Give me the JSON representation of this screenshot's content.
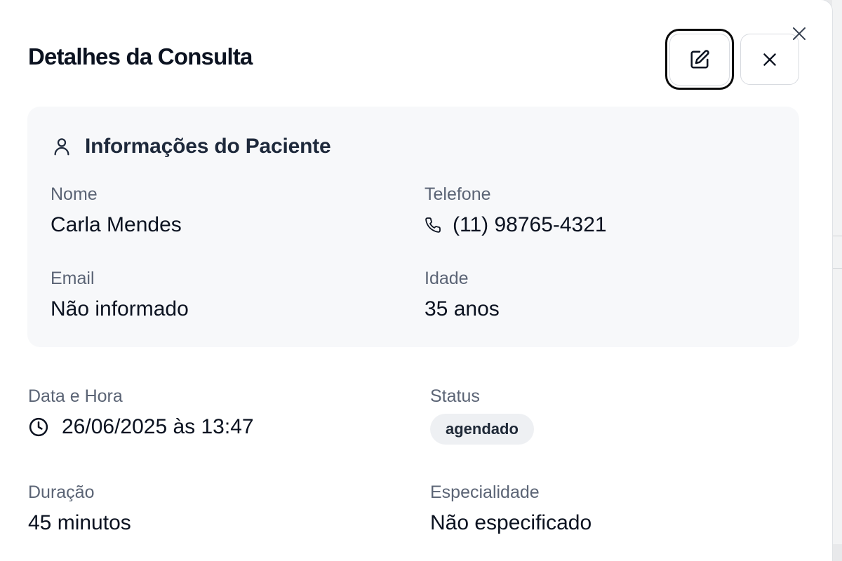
{
  "modal": {
    "title": "Detalhes da Consulta"
  },
  "patient": {
    "section_title": "Informações do Paciente",
    "name_label": "Nome",
    "name_value": "Carla Mendes",
    "phone_label": "Telefone",
    "phone_value": "(11) 98765-4321",
    "email_label": "Email",
    "email_value": "Não informado",
    "age_label": "Idade",
    "age_value": "35 anos"
  },
  "appointment": {
    "datetime_label": "Data e Hora",
    "datetime_value": "26/06/2025 às 13:47",
    "status_label": "Status",
    "status_value": "agendado",
    "duration_label": "Duração",
    "duration_value": "45 minutos",
    "specialty_label": "Especialidade",
    "specialty_value": "Não especificado"
  },
  "icons": {
    "edit": "pencil-square-icon",
    "close": "x-icon",
    "patient": "user-icon",
    "phone": "phone-icon",
    "clock": "clock-icon"
  },
  "colors": {
    "card_background": "#f7f8fa",
    "badge_background": "#eef0f3",
    "label_text": "#5b6475",
    "focus_ring": "#0b0b0b"
  }
}
